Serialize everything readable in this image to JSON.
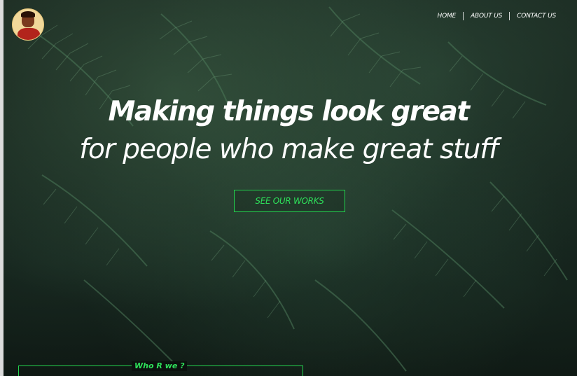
{
  "nav": {
    "items": [
      {
        "label": "HOME"
      },
      {
        "label": "ABOUT US"
      },
      {
        "label": "CONTACT US"
      }
    ]
  },
  "hero": {
    "headline": "Making things look great",
    "subline": "for people who make great stuff",
    "cta_label": "SEE OUR WORKS"
  },
  "about": {
    "section_label": "Who R we ?"
  },
  "colors": {
    "accent": "#23d24e",
    "text": "#ffffff",
    "background": "#0c1310"
  },
  "icons": {
    "avatar": "profile-avatar"
  }
}
